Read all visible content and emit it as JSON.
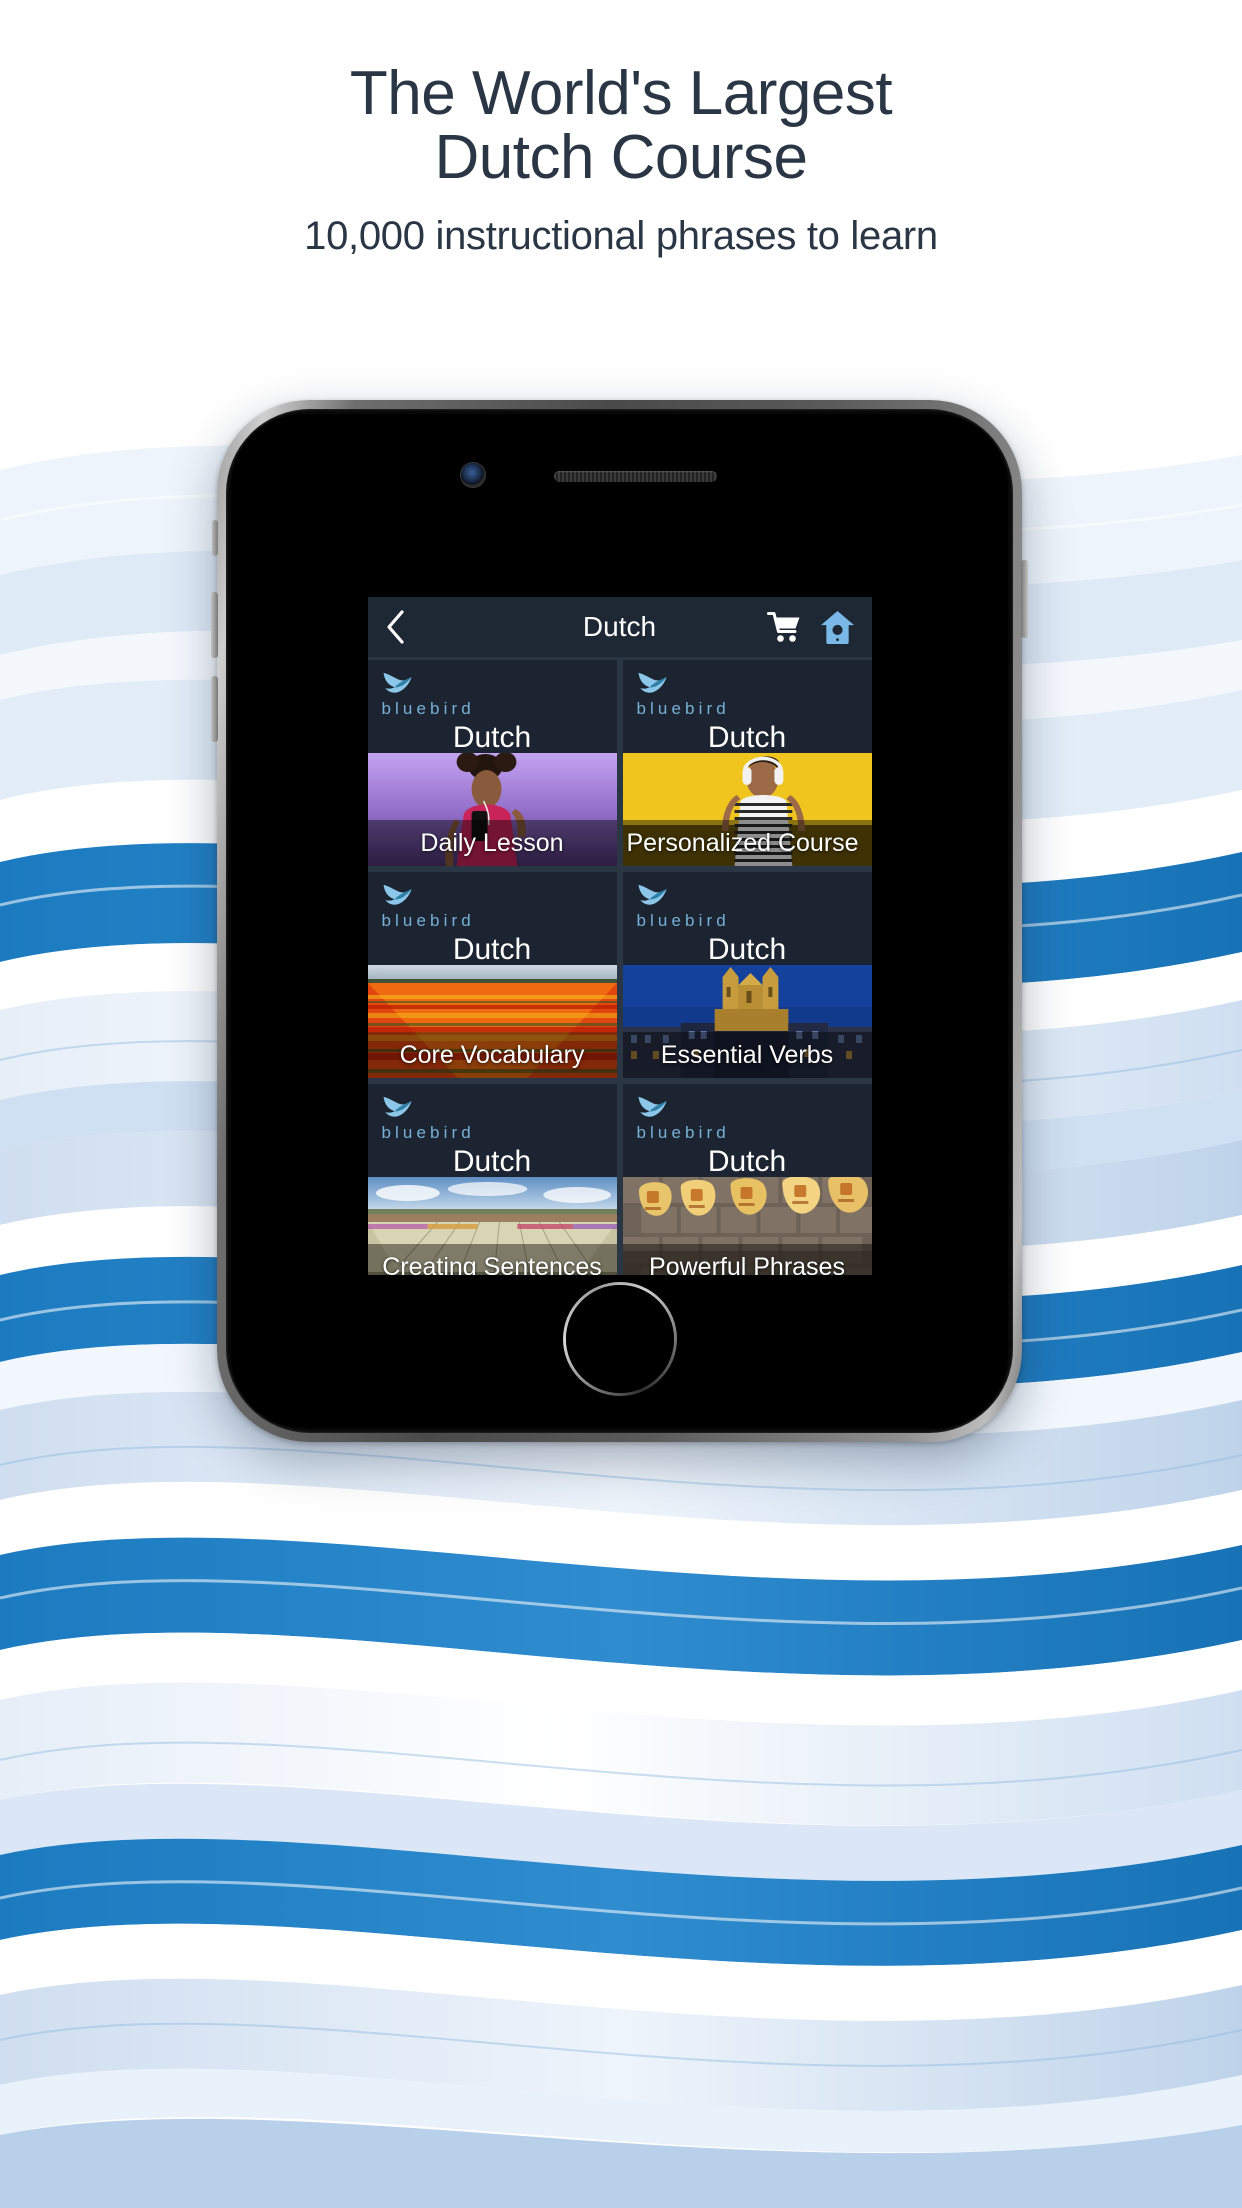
{
  "promo": {
    "headline_line1": "The World's Largest",
    "headline_line2": "Dutch Course",
    "subheadline": "10,000 instructional phrases to learn",
    "text_color": "#2b3644"
  },
  "device": {
    "frame_color": "#6e6e6e",
    "screen_bg": "#161d27"
  },
  "app": {
    "navbar": {
      "back_label": "‹",
      "title": "Dutch",
      "cart_icon": "shopping-cart-icon",
      "home_icon": "birdhouse-icon",
      "bg_color": "#1e2835",
      "accent_color": "#7ab8e8"
    },
    "brand": {
      "name": "bluebird",
      "bird_icon": "bluebird-logo-icon",
      "color": "#77b0d6"
    },
    "language": "Dutch",
    "cards": [
      {
        "brand": "bluebird",
        "language": "Dutch",
        "label": "Daily Lesson",
        "photo": "woman-with-phone-purple-bg",
        "photo_bg": "#b48ee8",
        "clipped": false
      },
      {
        "brand": "bluebird",
        "language": "Dutch",
        "label": "Personalized Course",
        "photo": "woman-headphones-yellow-bg",
        "photo_bg": "#f0c61e",
        "clipped": true
      },
      {
        "brand": "bluebird",
        "language": "Dutch",
        "label": "Core Vocabulary",
        "photo": "tulip-field",
        "photo_bg": "#c8401a",
        "clipped": false
      },
      {
        "brand": "bluebird",
        "language": "Dutch",
        "label": "Essential Verbs",
        "photo": "amsterdam-church-night",
        "photo_bg": "#1d3f8f",
        "clipped": false
      },
      {
        "brand": "bluebird",
        "language": "Dutch",
        "label": "Creating Sentences",
        "photo": "flower-fields-landscape",
        "photo_bg": "#8fae6e",
        "clipped": false
      },
      {
        "brand": "bluebird",
        "language": "Dutch",
        "label": "Powerful Phrases",
        "photo": "wooden-clogs-on-cobblestone",
        "photo_bg": "#b08a4a",
        "clipped": false
      }
    ]
  },
  "background": {
    "wave_blue": "#1c7bc0",
    "wave_pale": "#d7e4f2",
    "wave_white": "#ffffff"
  }
}
